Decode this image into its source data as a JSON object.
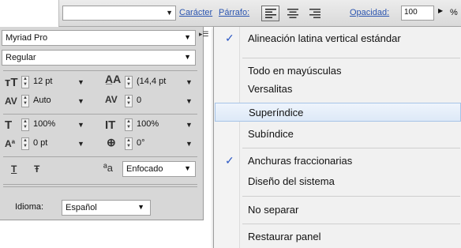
{
  "topbar": {
    "font_combo_value": "",
    "character_link": "Carácter",
    "paragraph_link": "Párrafo:",
    "align_buttons": [
      "align-left",
      "align-center",
      "align-right"
    ],
    "opacity_link": "Opacidad:",
    "opacity_value": "100",
    "percent": "%"
  },
  "panel": {
    "font_family": "Myriad Pro",
    "font_style": "Regular",
    "font_size": "12 pt",
    "leading": "(14,4 pt",
    "kerning": "Auto",
    "tracking": "0",
    "vertical_scale": "100%",
    "horizontal_scale": "100%",
    "baseline_shift": "0 pt",
    "rotation": "0°",
    "underline_glyph": "T",
    "strike_glyph": "Ŧ",
    "aa_glyph": "ªa",
    "antialias": "Enfocado",
    "language_label": "Idioma:",
    "language": "Español"
  },
  "menu": {
    "items": [
      {
        "label": "Alineación latina vertical estándar",
        "checked": true
      },
      {
        "label": "Todo en mayúsculas",
        "checked": false
      },
      {
        "label": "Versalitas",
        "checked": false
      },
      {
        "label": "Superíndice",
        "checked": false,
        "highlighted": true
      },
      {
        "label": "Subíndice",
        "checked": false
      },
      {
        "label": "Anchuras fraccionarias",
        "checked": true
      },
      {
        "label": "Diseño del sistema",
        "checked": false
      },
      {
        "label": "No separar",
        "checked": false
      },
      {
        "label": "Restaurar panel",
        "checked": false
      }
    ],
    "check_glyph": "✓"
  },
  "colors": {
    "link": "#2b55b0",
    "check": "#2d59c4",
    "highlight_border": "#a7c4e7"
  }
}
